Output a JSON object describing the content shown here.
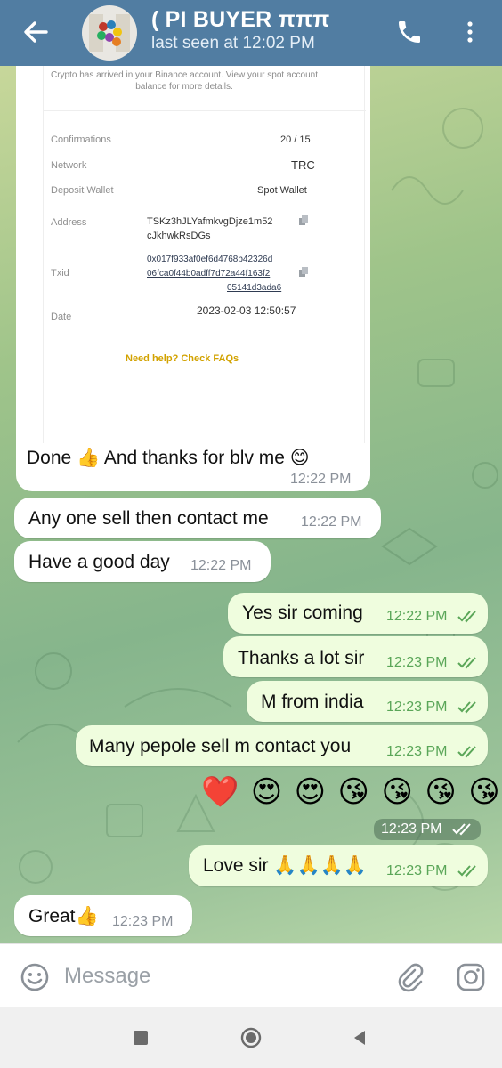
{
  "header": {
    "title": "( PI BUYER πππ",
    "status": "last seen at 12:02 PM"
  },
  "receipt": {
    "intro": "Crypto has arrived in your Binance account. View your spot account balance for more details.",
    "rows": {
      "confirmations_label": "Confirmations",
      "confirmations_value": "20 / 15",
      "network_label": "Network",
      "network_value": "TRC",
      "wallet_label": "Deposit Wallet",
      "wallet_value": "Spot Wallet",
      "address_label": "Address",
      "address_line1": "TSKz3hJLYafmkvgDjze1m52",
      "address_line2": "cJkhwkRsDGs",
      "txid_label": "Txid",
      "txid_line1": "0x017f933af0ef6d4768b42326d",
      "txid_line2": "06fca0f44b0adff7d72a44f163f2",
      "txid_line3": "05141d3ada6",
      "date_label": "Date",
      "date_value": "2023-02-03 12:50:57"
    },
    "faq": "Need help? Check FAQs"
  },
  "messages": [
    {
      "direction": "in",
      "text": "Done 👍 And thanks for blv me 😊",
      "time": "12:22 PM"
    },
    {
      "direction": "in",
      "text": "Any one sell then contact me",
      "time": "12:22 PM"
    },
    {
      "direction": "in",
      "text": "Have a good day",
      "time": "12:22 PM"
    },
    {
      "direction": "out",
      "text": "Yes sir coming",
      "time": "12:22 PM"
    },
    {
      "direction": "out",
      "text": "Thanks a lot sir",
      "time": "12:23 PM"
    },
    {
      "direction": "out",
      "text": "M from india",
      "time": "12:23 PM"
    },
    {
      "direction": "out",
      "text": "Many pepole sell m contact you",
      "time": "12:23 PM"
    },
    {
      "direction": "out",
      "text": "❤️ 😍 😍 😘 😘 😘 😘",
      "time": "12:23 PM"
    },
    {
      "direction": "out",
      "text": "Love sir 🙏🙏🙏🙏",
      "time": "12:23 PM"
    },
    {
      "direction": "in",
      "text": "Great👍",
      "time": "12:23 PM"
    }
  ],
  "input": {
    "placeholder": "Message"
  },
  "icons": {
    "back": "arrow-left-icon",
    "call": "phone-icon",
    "more": "more-vertical-icon",
    "emoji": "emoji-icon",
    "attach": "paperclip-icon",
    "camera": "instagram-camera-icon"
  },
  "colors": {
    "header": "#517da2",
    "incoming_bubble": "#ffffff",
    "outgoing_bubble": "#effdde",
    "outgoing_time": "#5aa658",
    "faq_link": "#d2a200"
  }
}
